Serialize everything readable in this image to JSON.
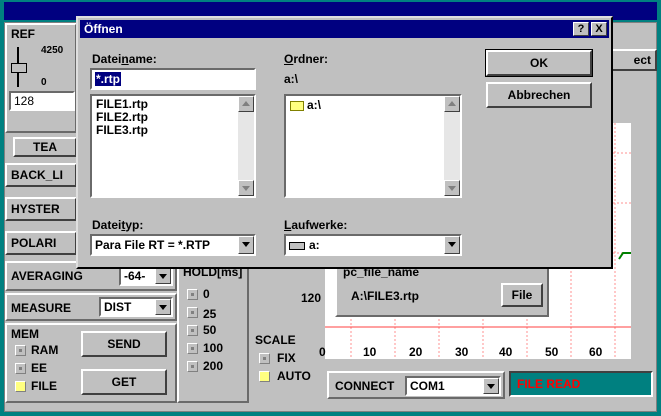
{
  "app": {
    "left_panel": {
      "ref_label": "REF",
      "ref_max": "4250",
      "ref_min": "0",
      "ref_value": "128",
      "teach_button": "TEA",
      "back_light_button": "BACK_LI",
      "hyster_button": "HYSTER",
      "polarity_button": "POLARI",
      "averaging_label": "AVERAGING",
      "averaging_value": "-64-",
      "measure_label": "MEASURE",
      "measure_value": "DIST",
      "mem_label": "MEM",
      "mem_options": [
        "RAM",
        "EE",
        "FILE"
      ],
      "send_button": "SEND",
      "get_button": "GET",
      "hold_label": "HOLD[ms]",
      "hold_options": [
        "0",
        "25",
        "50",
        "100",
        "200"
      ]
    },
    "select_button": "ect",
    "scale": {
      "label": "SCALE",
      "options": [
        "FIX",
        "AUTO"
      ],
      "y_value": "120"
    },
    "chart_axis": {
      "x_ticks": [
        "0",
        "10",
        "20",
        "30",
        "40",
        "50",
        "60"
      ]
    },
    "file_box": {
      "title": "pc_file_name",
      "path": "A:\\FILE3.rtp",
      "file_button": "File"
    },
    "connect": {
      "label": "CONNECT",
      "port": "COM1"
    },
    "status": {
      "text": "FILE READ",
      "text_color": "#ff0000",
      "bg_color": "#008080"
    }
  },
  "dialog": {
    "title": "Öffnen",
    "help_btn": "?",
    "close_btn": "X",
    "filename_label": "Dateiname:",
    "filename_value": "*.rtp",
    "files": [
      "FILE1.rtp",
      "FILE2.rtp",
      "FILE3.rtp"
    ],
    "folder_label": "Ordner:",
    "folder_path": "a:\\",
    "folders": [
      "a:\\"
    ],
    "filetype_label": "Dateityp:",
    "filetype_value": "Para File RT = *.RTP",
    "drives_label": "Laufwerke:",
    "drive_value": "a:",
    "ok_button": "OK",
    "cancel_button": "Abbrechen"
  }
}
